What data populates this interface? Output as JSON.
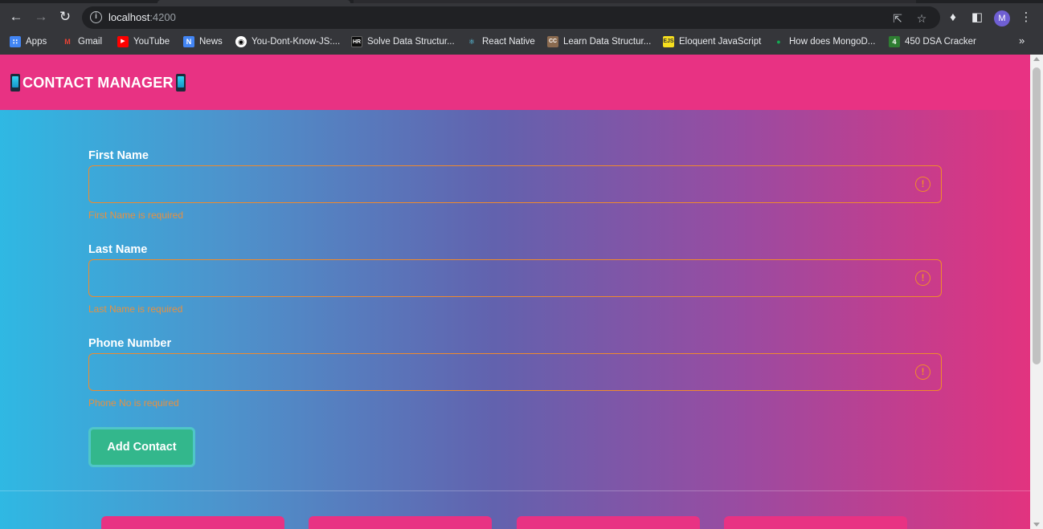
{
  "browser": {
    "url_host": "localhost",
    "url_port": ":4200",
    "avatar_letter": "M",
    "bookmarks": [
      {
        "label": "Apps",
        "icon": "apps-grid-icon",
        "color": "#f4b400"
      },
      {
        "label": "Gmail",
        "icon": "gmail-icon",
        "color": "#ea4335"
      },
      {
        "label": "YouTube",
        "icon": "youtube-icon",
        "color": "#ff0000"
      },
      {
        "label": "News",
        "icon": "news-icon",
        "color": "#4285f4"
      },
      {
        "label": "You-Dont-Know-JS:...",
        "icon": "github-icon",
        "color": "#ffffff"
      },
      {
        "label": "Solve Data Structur...",
        "icon": "hackerrank-icon",
        "color": "#1b1b1b"
      },
      {
        "label": "React Native",
        "icon": "react-icon",
        "color": "#61dafb"
      },
      {
        "label": "Learn Data Structur...",
        "icon": "codechef-icon",
        "color": "#8a6a4f"
      },
      {
        "label": "Eloquent JavaScript",
        "icon": "js-icon",
        "color": "#f7df1e"
      },
      {
        "label": "How does MongoD...",
        "icon": "mongodb-leaf-icon",
        "color": "#13aa52"
      },
      {
        "label": "450 DSA Cracker",
        "icon": "dsa-4-icon",
        "color": "#2e7d32"
      }
    ]
  },
  "app": {
    "brand": "CONTACT MANAGER",
    "colors": {
      "navbar": "#e83283",
      "error": "#f08a2c",
      "button": "#33b78c"
    }
  },
  "form": {
    "first_name": {
      "label": "First Name",
      "value": "",
      "error": "First Name is required"
    },
    "last_name": {
      "label": "Last Name",
      "value": "",
      "error": "Last Name is required"
    },
    "phone": {
      "label": "Phone Number",
      "value": "",
      "error": "Phone No is required"
    },
    "submit_label": "Add Contact"
  }
}
